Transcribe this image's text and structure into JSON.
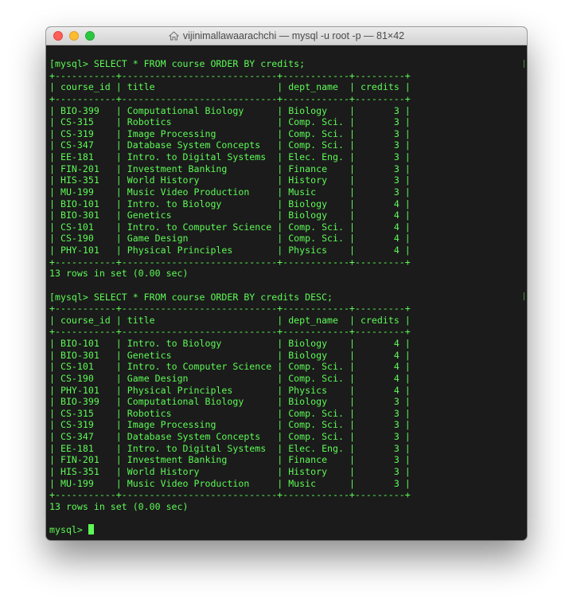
{
  "window": {
    "title": "vijinimallawaarachchi — mysql -u root -p — 81×42"
  },
  "terminal": {
    "prompt": "mysql> ",
    "query1": {
      "prefix": "[",
      "command": "SELECT * FROM course ORDER BY credits;"
    },
    "query2": {
      "prefix": "[",
      "command": "SELECT * FROM course ORDER BY credits DESC;"
    },
    "table1": {
      "columns": [
        "course_id",
        "title",
        "dept_name",
        "credits"
      ],
      "rows": [
        [
          "BIO-399",
          "Computational Biology",
          "Biology",
          "3"
        ],
        [
          "CS-315",
          "Robotics",
          "Comp. Sci.",
          "3"
        ],
        [
          "CS-319",
          "Image Processing",
          "Comp. Sci.",
          "3"
        ],
        [
          "CS-347",
          "Database System Concepts",
          "Comp. Sci.",
          "3"
        ],
        [
          "EE-181",
          "Intro. to Digital Systems",
          "Elec. Eng.",
          "3"
        ],
        [
          "FIN-201",
          "Investment Banking",
          "Finance",
          "3"
        ],
        [
          "HIS-351",
          "World History",
          "History",
          "3"
        ],
        [
          "MU-199",
          "Music Video Production",
          "Music",
          "3"
        ],
        [
          "BIO-101",
          "Intro. to Biology",
          "Biology",
          "4"
        ],
        [
          "BIO-301",
          "Genetics",
          "Biology",
          "4"
        ],
        [
          "CS-101",
          "Intro. to Computer Science",
          "Comp. Sci.",
          "4"
        ],
        [
          "CS-190",
          "Game Design",
          "Comp. Sci.",
          "4"
        ],
        [
          "PHY-101",
          "Physical Principles",
          "Physics",
          "4"
        ]
      ],
      "summary": "13 rows in set (0.00 sec)"
    },
    "table2": {
      "columns": [
        "course_id",
        "title",
        "dept_name",
        "credits"
      ],
      "rows": [
        [
          "BIO-101",
          "Intro. to Biology",
          "Biology",
          "4"
        ],
        [
          "BIO-301",
          "Genetics",
          "Biology",
          "4"
        ],
        [
          "CS-101",
          "Intro. to Computer Science",
          "Comp. Sci.",
          "4"
        ],
        [
          "CS-190",
          "Game Design",
          "Comp. Sci.",
          "4"
        ],
        [
          "PHY-101",
          "Physical Principles",
          "Physics",
          "4"
        ],
        [
          "BIO-399",
          "Computational Biology",
          "Biology",
          "3"
        ],
        [
          "CS-315",
          "Robotics",
          "Comp. Sci.",
          "3"
        ],
        [
          "CS-319",
          "Image Processing",
          "Comp. Sci.",
          "3"
        ],
        [
          "CS-347",
          "Database System Concepts",
          "Comp. Sci.",
          "3"
        ],
        [
          "EE-181",
          "Intro. to Digital Systems",
          "Elec. Eng.",
          "3"
        ],
        [
          "FIN-201",
          "Investment Banking",
          "Finance",
          "3"
        ],
        [
          "HIS-351",
          "World History",
          "History",
          "3"
        ],
        [
          "MU-199",
          "Music Video Production",
          "Music",
          "3"
        ]
      ],
      "summary": "13 rows in set (0.00 sec)"
    }
  },
  "colors": {
    "terminal_text": "#5dfa56",
    "terminal_background": "#1b1b1b",
    "close": "#fc5f57",
    "minimize": "#fdbc2e",
    "maximize": "#28c840"
  },
  "icons": {
    "title": "home-icon"
  }
}
